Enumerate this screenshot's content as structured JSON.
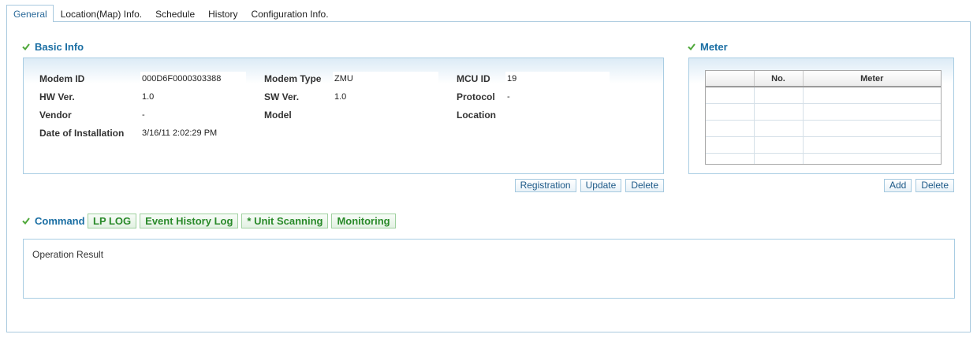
{
  "tabs": [
    {
      "label": "General",
      "active": true
    },
    {
      "label": "Location(Map) Info.",
      "active": false
    },
    {
      "label": "Schedule",
      "active": false
    },
    {
      "label": "History",
      "active": false
    },
    {
      "label": "Configuration Info.",
      "active": false
    }
  ],
  "basic_info": {
    "title": "Basic Info",
    "icon": "check-icon",
    "modem_id": {
      "label": "Modem ID",
      "value": "000D6F0000303388"
    },
    "modem_type": {
      "label": "Modem Type",
      "value": "ZMU"
    },
    "mcu_id": {
      "label": "MCU ID",
      "value": "19"
    },
    "hw_ver": {
      "label": "HW Ver.",
      "value": "1.0"
    },
    "sw_ver": {
      "label": "SW Ver.",
      "value": "1.0"
    },
    "protocol": {
      "label": "Protocol",
      "value": "-"
    },
    "vendor": {
      "label": "Vendor",
      "value": "-"
    },
    "model": {
      "label": "Model",
      "value": ""
    },
    "location": {
      "label": "Location",
      "value": ""
    },
    "date_of_installation": {
      "label": "Date of Installation",
      "value": "3/16/11 2:02:29 PM"
    },
    "buttons": {
      "registration": "Registration",
      "update": "Update",
      "delete": "Delete"
    }
  },
  "meter": {
    "title": "Meter",
    "icon": "check-icon",
    "columns": [
      "",
      "No.",
      "Meter"
    ],
    "rows": [],
    "buttons": {
      "add": "Add",
      "delete": "Delete"
    }
  },
  "command": {
    "title": "Command",
    "icon": "check-icon",
    "buttons": [
      "LP LOG",
      "Event History Log",
      "* Unit Scanning",
      "Monitoring"
    ]
  },
  "operation_result": {
    "label": "Operation Result",
    "value": ""
  },
  "colors": {
    "section_title": "#1a6ea3",
    "active_tab_text": "#2b6a9a",
    "command_button_text": "#2a8a2a",
    "box_border": "#a9cde3",
    "check_icon": "#4fa83a"
  }
}
